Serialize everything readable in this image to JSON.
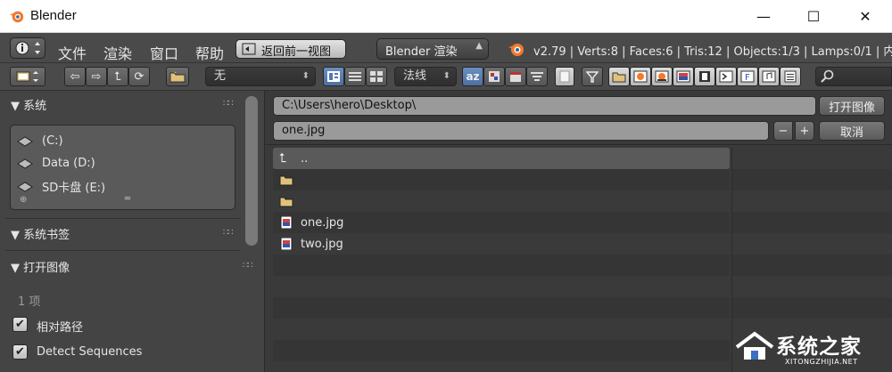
{
  "window": {
    "title": "Blender",
    "minimize": "—",
    "maximize": "☐",
    "close": "✕"
  },
  "menu": {
    "file": "文件",
    "render": "渲染",
    "window": "窗口",
    "help": "帮助",
    "back": "返回前一视图",
    "engine": "Blender 渲染",
    "stats": "v2.79 | Verts:8 | Faces:6 | Tris:12 | Objects:1/3 | Lamps:0/1 | 内"
  },
  "toolbar": {
    "filter_dropdown": "无",
    "sort_dropdown": "法线",
    "sort_alpha": "az"
  },
  "left": {
    "system_header": "系统",
    "drives": [
      "(C:)",
      "Data (D:)",
      "SD卡盘 (E:)"
    ],
    "bookmarks_header": "系统书签",
    "open_image_header": "打开图像",
    "item_count": "1 项",
    "relative_path_label": "相对路径",
    "detect_sequences_label": "Detect Sequences",
    "relative_path_checked": true,
    "detect_sequences_checked": true
  },
  "right": {
    "directory": "C:\\Users\\hero\\Desktop\\",
    "filename": "one.jpg",
    "open_button": "打开图像",
    "cancel_button": "取消",
    "decrement": "−",
    "increment": "+",
    "parent_dir": "..",
    "files": [
      "one.jpg",
      "two.jpg"
    ]
  },
  "watermark": {
    "brand": "系统之家",
    "url": "XITONGZHIJIA.NET"
  },
  "colors": {
    "accent_blue": "#5577aa",
    "blender_orange": "#f5792a",
    "panel_bg": "#444444",
    "file_bg": "#3a3a3a"
  }
}
